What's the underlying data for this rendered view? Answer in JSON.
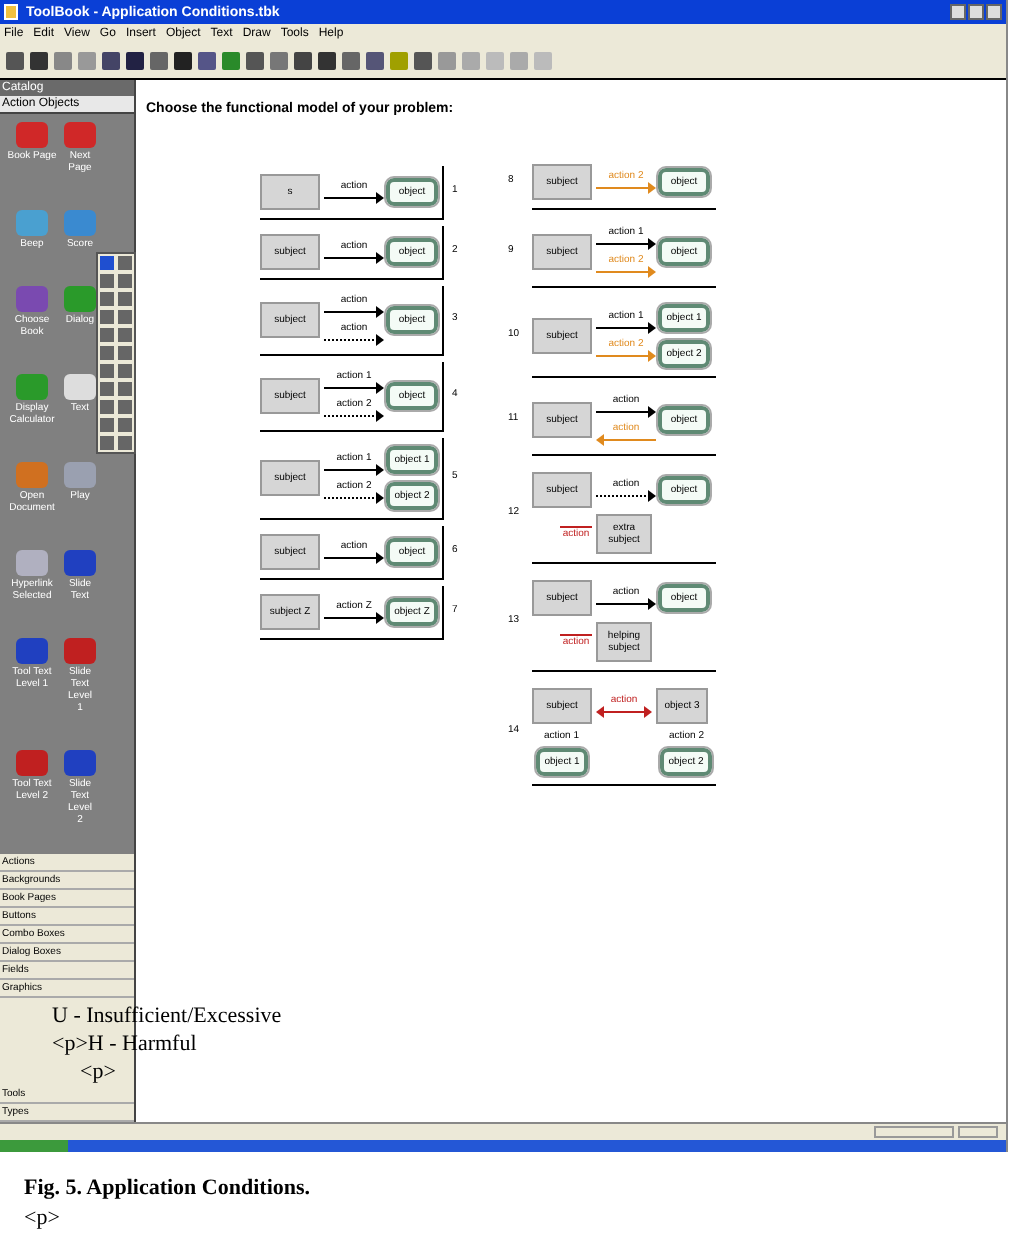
{
  "window": {
    "title": "ToolBook - Application Conditions.tbk"
  },
  "menu": [
    "File",
    "Edit",
    "View",
    "Go",
    "Insert",
    "Object",
    "Text",
    "Draw",
    "Tools",
    "Help"
  ],
  "catalog": {
    "title": "Catalog",
    "category": "Action Objects",
    "items": [
      "Book Page",
      "Next Page",
      "Beep",
      "Score",
      "Choose Book",
      "Dialog",
      "Display Calculator",
      "Text",
      "Open Document",
      "Play",
      "Hyperlink Selected",
      "Slide Text",
      "Tool Text Level 1",
      "Slide Text Level 1",
      "Tool Text Level 2",
      "Slide Text Level 2"
    ]
  },
  "categories": [
    "Actions",
    "Backgrounds",
    "Book Pages",
    "Buttons",
    "Combo Boxes",
    "Dialog Boxes",
    "Fields",
    "Graphics",
    "Tools",
    "Types"
  ],
  "heading": "Choose the functional model of your problem:",
  "left_models": [
    {
      "number": "1",
      "kind": "chain",
      "subject": "s",
      "actions": [
        {
          "label": "action",
          "kind": "normal"
        }
      ],
      "objects": [
        "object"
      ]
    },
    {
      "number": "2",
      "kind": "chain",
      "subject": "subject",
      "actions": [
        {
          "label": "action",
          "kind": "normal"
        }
      ],
      "objects": [
        "object"
      ]
    },
    {
      "number": "3",
      "kind": "chain",
      "subject": "subject",
      "actions": [
        {
          "label": "action",
          "kind": "normal"
        },
        {
          "label": "action",
          "kind": "dotted"
        }
      ],
      "objects": [
        "object"
      ]
    },
    {
      "number": "4",
      "kind": "chain",
      "subject": "subject",
      "actions": [
        {
          "label": "action 1",
          "kind": "normal"
        },
        {
          "label": "action 2",
          "kind": "dotted"
        }
      ],
      "objects": [
        "object"
      ]
    },
    {
      "number": "5",
      "kind": "chain",
      "subject": "subject",
      "actions": [
        {
          "label": "action 1",
          "kind": "normal"
        },
        {
          "label": "action 2",
          "kind": "dotted"
        }
      ],
      "objects": [
        "object 1",
        "object 2"
      ]
    },
    {
      "number": "6",
      "kind": "chain",
      "subject": "subject",
      "actions": [
        {
          "label": "action",
          "kind": "normal"
        }
      ],
      "objects": [
        "object"
      ]
    },
    {
      "number": "7",
      "kind": "chain",
      "subject": "subject Z",
      "actions": [
        {
          "label": "action Z",
          "kind": "normal"
        }
      ],
      "objects": [
        "object Z"
      ]
    }
  ],
  "right_models": [
    {
      "number": "8",
      "kind": "chain",
      "subject": "subject",
      "actions": [
        {
          "label": "action 2",
          "kind": "harmful"
        }
      ],
      "objects": [
        "object"
      ]
    },
    {
      "number": "9",
      "kind": "chain",
      "subject": "subject",
      "actions": [
        {
          "label": "action 1",
          "kind": "normal"
        },
        {
          "label": "action 2",
          "kind": "harmful"
        }
      ],
      "objects": [
        "object"
      ]
    },
    {
      "number": "10",
      "kind": "chain",
      "subject": "subject",
      "actions": [
        {
          "label": "action 1",
          "kind": "normal"
        },
        {
          "label": "action 2",
          "kind": "harmful"
        }
      ],
      "objects": [
        "object 1",
        "object 2"
      ]
    },
    {
      "number": "11",
      "kind": "chain",
      "subject": "subject",
      "actions": [
        {
          "label": "action",
          "kind": "normal"
        },
        {
          "label": "action",
          "kind": "harmful_reverse"
        }
      ],
      "objects": [
        "object"
      ]
    },
    {
      "number": "12",
      "kind": "extra",
      "subject": "subject",
      "actions": [
        {
          "label": "action",
          "kind": "dotted"
        }
      ],
      "objects": [
        "object"
      ],
      "extra": {
        "subject": "extra subject",
        "action": "action"
      }
    },
    {
      "number": "13",
      "kind": "extra",
      "subject": "subject",
      "actions": [
        {
          "label": "action",
          "kind": "normal"
        }
      ],
      "objects": [
        "object"
      ],
      "extra": {
        "subject": "helping subject",
        "action": "action"
      }
    },
    {
      "number": "14",
      "kind": "pair",
      "subjects": [
        "subject",
        "object 3"
      ],
      "link": "action",
      "actions": [
        "action 1",
        "action 2"
      ],
      "objects": [
        "object 1",
        "object 2"
      ]
    }
  ],
  "legend": [
    "U - Insufficient/Excessive",
    "<p>H - Harmful",
    "<p>"
  ],
  "caption": {
    "title": "Fig. 5. Application Conditions.",
    "tag": "<p>"
  }
}
